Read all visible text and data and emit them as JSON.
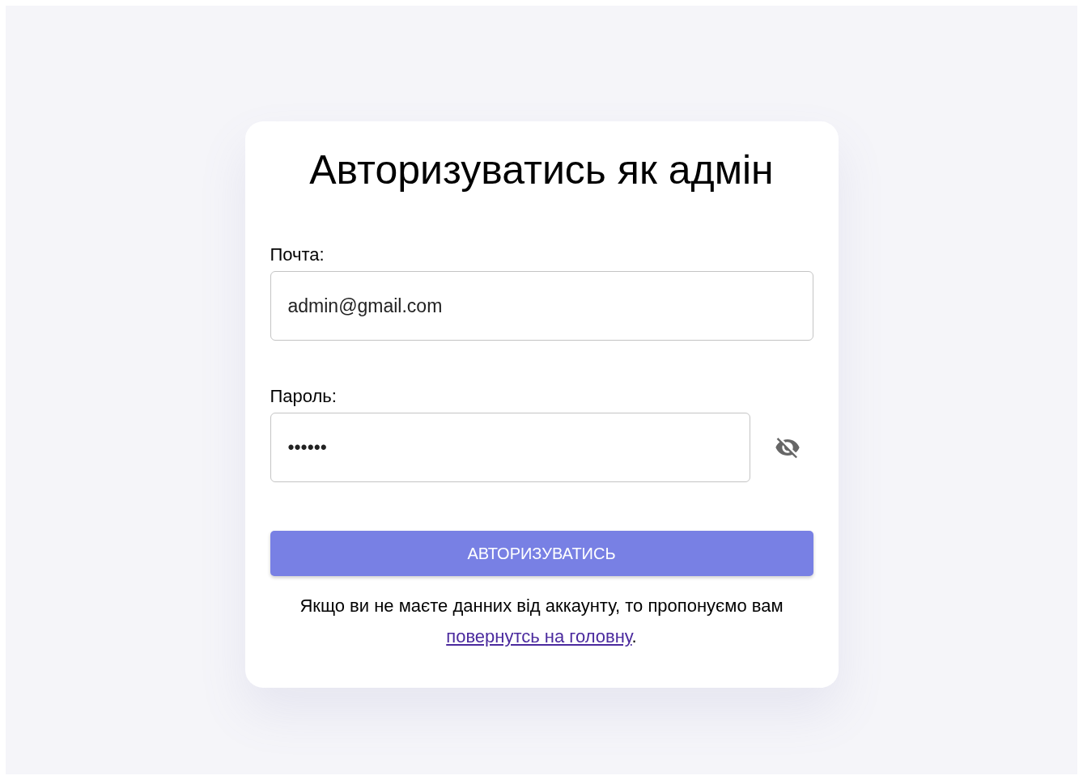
{
  "title": "Авторизуватись як адмін",
  "fields": [
    {
      "label": "Почта:",
      "value": "admin@gmail.com",
      "kind": "email"
    },
    {
      "label": "Пароль:",
      "value": "••••••",
      "kind": "password"
    }
  ],
  "submit": "АВТОРИЗУВАТИСЬ",
  "footer": {
    "before": "Якщо ви не маєте данних від аккаунту, то пропонуємо вам",
    "link": "повернутсь на головну",
    "after": "."
  }
}
